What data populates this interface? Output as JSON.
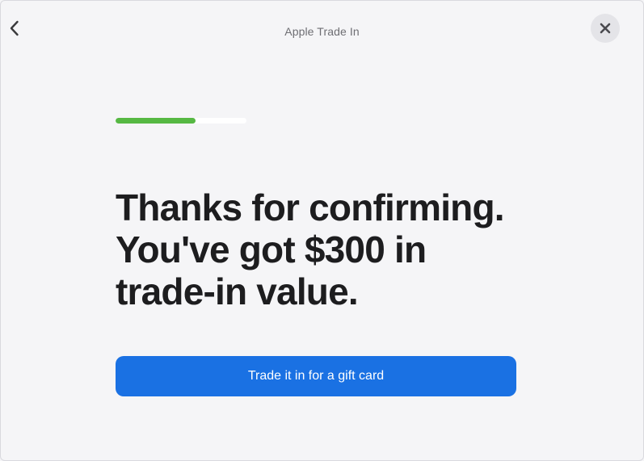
{
  "header": {
    "title": "Apple Trade In",
    "back_icon": "chevron-left-icon",
    "close_icon": "close-icon"
  },
  "progress": {
    "value_fraction": 0.61,
    "fill_color": "#56b843",
    "track_color": "#ffffff"
  },
  "main": {
    "headline_lines": [
      "Thanks for confirming.",
      "You've got $300 in",
      "trade-in value."
    ],
    "cta_label": "Trade it in for a gift card",
    "cta_color": "#1a71e3"
  }
}
